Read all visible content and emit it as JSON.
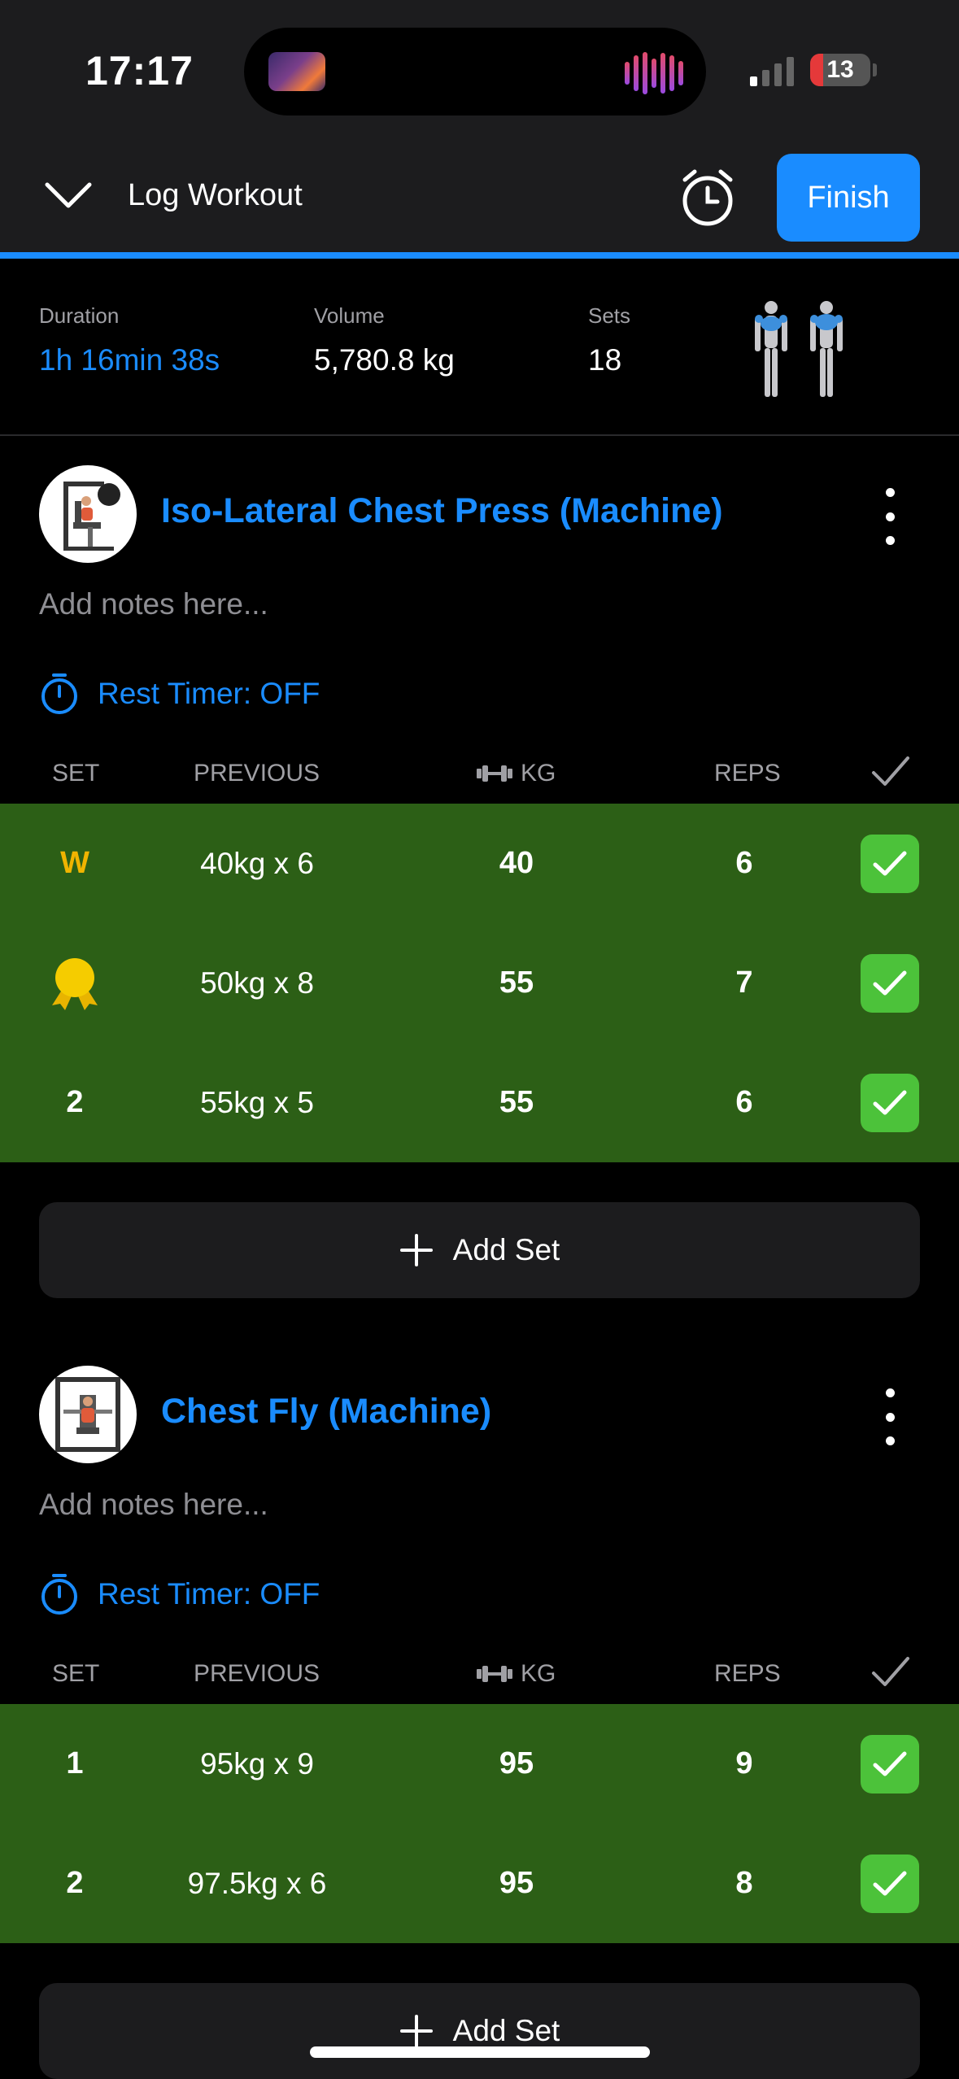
{
  "status_bar": {
    "time": "17:17",
    "battery": "13"
  },
  "header": {
    "title": "Log Workout",
    "finish_label": "Finish"
  },
  "stats": [
    {
      "label": "Duration",
      "value": "1h 16min 38s"
    },
    {
      "label": "Volume",
      "value": "5,780.8 kg"
    },
    {
      "label": "Sets",
      "value": "18"
    }
  ],
  "columns": {
    "set": "SET",
    "previous": "PREVIOUS",
    "kg": "KG",
    "reps": "REPS"
  },
  "exercises": [
    {
      "name": "Iso-Lateral Chest Press (Machine)",
      "notes_placeholder": "Add notes here...",
      "rest_timer": "Rest Timer: OFF",
      "add_set": "Add Set",
      "sets": [
        {
          "set": "W",
          "previous": "40kg x 6",
          "kg": "40",
          "reps": "6",
          "done": true
        },
        {
          "set": "",
          "previous": "50kg x 8",
          "kg": "55",
          "reps": "7",
          "done": true,
          "icon": "medal-icon"
        },
        {
          "set": "2",
          "previous": "55kg x 5",
          "kg": "55",
          "reps": "6",
          "done": true
        }
      ]
    },
    {
      "name": "Chest Fly (Machine)",
      "notes_placeholder": "Add notes here...",
      "rest_timer": "Rest Timer: OFF",
      "add_set": "Add Set",
      "sets": [
        {
          "set": "1",
          "previous": "95kg x 9",
          "kg": "95",
          "reps": "9",
          "done": true
        },
        {
          "set": "2",
          "previous": "97.5kg x 6",
          "kg": "95",
          "reps": "8",
          "done": true
        }
      ]
    }
  ],
  "colors": {
    "accent": "#1a8cff",
    "done_row": "#2c5f16",
    "check": "#4cc23a",
    "warmup": "#f0b400"
  }
}
